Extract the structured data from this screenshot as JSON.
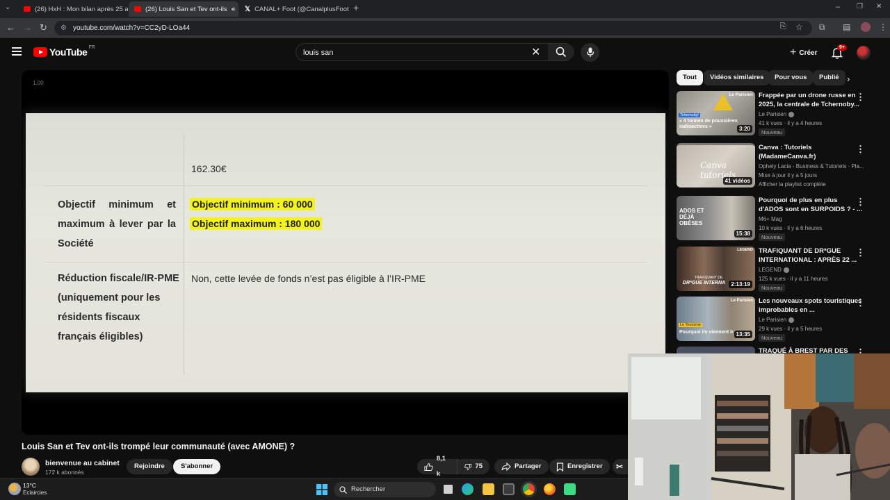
{
  "browser": {
    "tabs": [
      {
        "title": "(26) HxH : Mon bilan après 25 a",
        "icon": "youtube-icon",
        "active": false
      },
      {
        "title": "(26) Louis San et Tev ont-ils",
        "icon": "youtube-icon",
        "active": true
      },
      {
        "title": "CANAL+ Foot (@CanalplusFoot",
        "icon": "x-icon",
        "active": false
      }
    ],
    "new_tab": "+",
    "url": "youtube.com/watch?v=CC2yD-LOa44"
  },
  "youtube": {
    "logo_text": "YouTube",
    "country_code": "FR",
    "search": {
      "value": "louis san",
      "placeholder": "Rechercher"
    },
    "create_label": "Créer",
    "notifications_badge": "9+"
  },
  "video": {
    "speed_overlay": "1.00",
    "document": {
      "price": "162.30€",
      "row1_label": "Objectif minimum et maximum à lever par la Société",
      "highlight_min": "Objectif minimum : 60 000",
      "highlight_max": "Objectif maximum : 180 000",
      "row2_label": "Réduction fiscale/IR-PME (uniquement pour les résidents fiscaux français éligibles)",
      "row2_value": "Non, cette levée de fonds n’est pas éligible à l’IR-PME",
      "highlight_color": "#f3f21b"
    },
    "title": "Louis San et Tev ont-ils trompé leur communauté (avec AMONE) ?",
    "channel": {
      "name": "bienvenue au cabinet",
      "subscribers": "172 k abonnés"
    },
    "join_label": "Rejoindre",
    "subscribe_label": "S'abonner",
    "likes": "8,1 k",
    "dislikes": "75",
    "share_label": "Partager",
    "save_label": "Enregistrer"
  },
  "sidebar": {
    "chips": [
      "Tout",
      "Vidéos similaires",
      "Pour vous",
      "Publié"
    ],
    "recommendations": [
      {
        "title": "Frappée par un drone russe en 2025, la centrale de Tchernoby...",
        "channel": "Le Parisien",
        "verified": true,
        "meta": "41 k vues · il y a 4 heures",
        "badge": "Nouveau",
        "duration": "3:20",
        "thumb_text": "« 4 tonnes de poussières radioactives »",
        "thumb_tag": "Tchernobyl",
        "thumb_brand": "Le Parisien"
      },
      {
        "title": "Canva : Tutoriels (MadameCanva.fr)",
        "channel": "Ophely Lacia - Business & Tutoriels · Pla...",
        "verified": false,
        "meta": "Mise à jour il y a 5 jours",
        "badge_link": "Afficher la playlist complète",
        "duration": "41 vidéos",
        "thumb_text": "Canva tutoriels"
      },
      {
        "title": "Pourquoi de plus en plus d'ADOS sont en SURPOIDS ? - ...",
        "channel": "M6+ Mag",
        "verified": false,
        "meta": "10 k vues · il y a 6 heures",
        "badge": "Nouveau",
        "duration": "15:38",
        "thumb_text": "ADOS ET DÉJÀ OBÈSES"
      },
      {
        "title": "TRAFIQUANT DE DR*GUE INTERNATIONAL : APRÈS 22 ...",
        "channel": "LEGEND",
        "verified": true,
        "meta": "125 k vues · il y a 11 heures",
        "badge": "Nouveau",
        "duration": "2:13:19",
        "thumb_text": "DR*GUE INTERNA",
        "thumb_tag": "TRAFIQUANT DE",
        "thumb_brand": "LEGEND"
      },
      {
        "title": "Les nouveaux spots touristiques improbables en ...",
        "channel": "Le Parisien",
        "verified": true,
        "meta": "29 k vues · il y a 5 heures",
        "badge": "Nouveau",
        "duration": "13:35",
        "thumb_text": "Pourquoi ils viennent ir",
        "thumb_tag": "Le Tourisme",
        "thumb_brand": "Le Parisien"
      },
      {
        "title": "TRAQUÉ À BREST PAR DES",
        "channel": "",
        "meta": "",
        "duration": ""
      }
    ]
  },
  "taskbar": {
    "weather_temp": "13°C",
    "weather_desc": "Eclaircies",
    "search_label": "Rechercher"
  },
  "colors": {
    "youtube_red": "#ff0000",
    "background": "#0f0f0f"
  }
}
